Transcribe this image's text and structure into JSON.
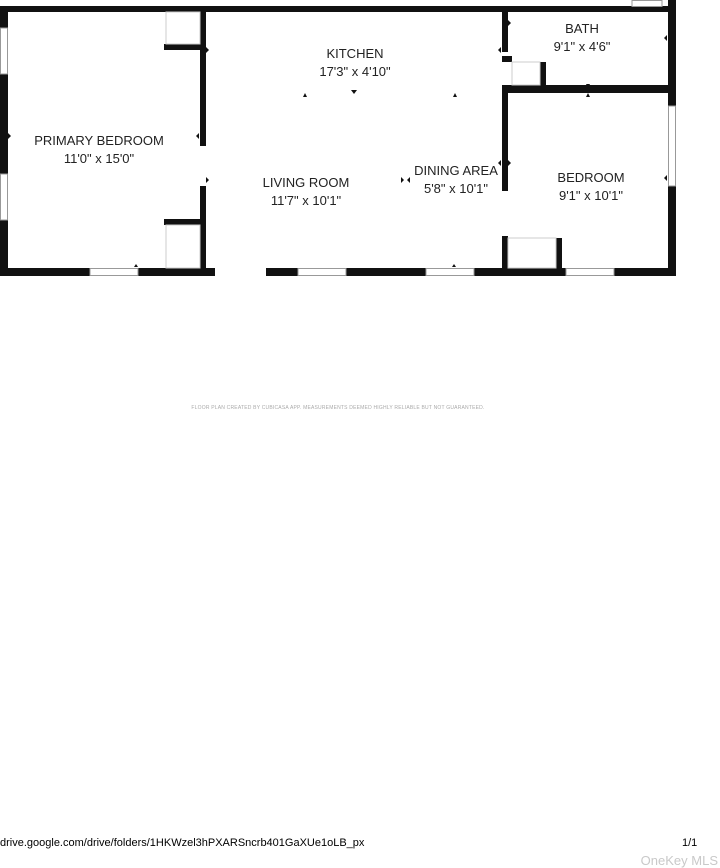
{
  "rooms": {
    "kitchen": {
      "name": "KITCHEN",
      "dims": "17'3\" x 4'10\""
    },
    "bath": {
      "name": "BATH",
      "dims": "9'1\" x 4'6\""
    },
    "primary_bedroom": {
      "name": "PRIMARY BEDROOM",
      "dims": "11'0\" x 15'0\""
    },
    "living_room": {
      "name": "LIVING ROOM",
      "dims": "11'7\" x 10'1\""
    },
    "dining_area": {
      "name": "DINING AREA",
      "dims": "5'8\" x 10'1\""
    },
    "bedroom": {
      "name": "BEDROOM",
      "dims": "9'1\" x 10'1\""
    }
  },
  "disclaimer": "FLOOR PLAN CREATED BY CUBICASA APP. MEASUREMENTS DEEMED HIGHLY RELIABLE BUT NOT GUARANTEED.",
  "footer": {
    "url": "drive.google.com/drive/folders/1HKWzel3hPXARSncrb401GaXUe1oLB_px",
    "page": "1/1"
  },
  "watermark": "OneKey MLS",
  "colors": {
    "wall": "#111111",
    "window": "#bbbbbb",
    "marker": "#111111"
  }
}
